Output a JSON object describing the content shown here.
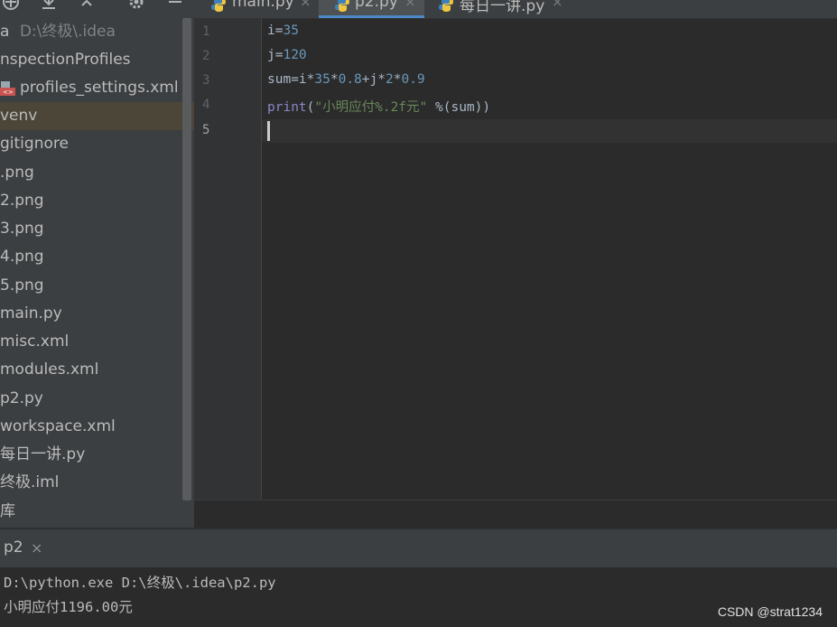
{
  "project_tree": {
    "items": [
      {
        "label": "D:\\终极\\.idea",
        "prefix": "a"
      },
      {
        "label": "nspectionProfiles"
      },
      {
        "label": "profiles_settings.xml"
      },
      {
        "label": "venv"
      },
      {
        "label": "gitignore"
      },
      {
        "label": ".png"
      },
      {
        "label": "2.png"
      },
      {
        "label": "3.png"
      },
      {
        "label": "4.png"
      },
      {
        "label": "5.png"
      },
      {
        "label": "main.py"
      },
      {
        "label": "misc.xml"
      },
      {
        "label": "modules.xml"
      },
      {
        "label": "p2.py"
      },
      {
        "label": "workspace.xml"
      },
      {
        "label": "每日一讲.py"
      },
      {
        "label": "终极.iml"
      },
      {
        "label": "库"
      }
    ],
    "selected_index": 3
  },
  "tabs": [
    {
      "label": "main.py",
      "close": "×"
    },
    {
      "label": "p2.py",
      "close": "×",
      "active": true
    },
    {
      "label": "每日一讲.py",
      "close": "×"
    }
  ],
  "editor": {
    "line_numbers": [
      "1",
      "2",
      "3",
      "4",
      "5"
    ],
    "lines": [
      "i=35",
      "j=120",
      "sum=i*35*0.8+j*2*0.9",
      "print(\"小明应付%.2f元\" %(sum))",
      ""
    ]
  },
  "run_panel": {
    "tab_label": "p2",
    "close": "×",
    "console": [
      "D:\\python.exe D:\\终极\\.idea\\p2.py",
      "小明应付1196.00元"
    ]
  },
  "watermark": "CSDN @strat1234",
  "colors": {
    "accent": "#4a88c7",
    "number": "#6897bb",
    "string": "#6a8759",
    "builtin": "#8888c6",
    "selection": "#4b4638"
  }
}
